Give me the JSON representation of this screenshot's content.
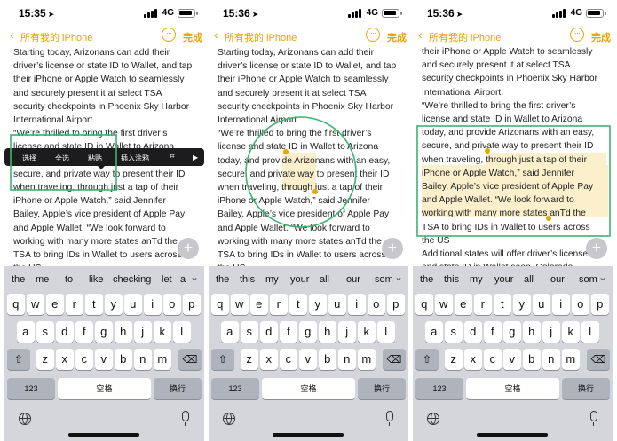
{
  "status": {
    "time_1": "15:35",
    "time_2": "15:36",
    "time_3": "15:36",
    "network": "4G"
  },
  "nav": {
    "back_label": "所有我的 iPhone",
    "done_label": "完成"
  },
  "note_lines_a": [
    "Starting today, Arizonans can add their",
    "driver’s license or state ID to Wallet, and tap",
    "their iPhone or Apple Watch to seamlessly",
    "and securely present it at select TSA",
    "security checkpoints in Phoenix Sky Harbor",
    "International Airport.",
    "“We’re thrilled to bring the first driver’s",
    "license and state ID in Wallet to Arizona",
    "today, and provide Arizonans with an easy,",
    "secure, and private way to present their ID",
    "when traveling, through just a tap of their",
    "iPhone or Apple Watch,” said Jennifer",
    "Bailey, Apple’s vice president of Apple Pay",
    "and Apple Wallet. “We look forward to",
    "working with many more states anTd the",
    "TSA to bring IDs in Wallet to users across",
    "the US"
  ],
  "note_lines_c": [
    "their iPhone or Apple Watch to seamlessly",
    "and securely present it at select TSA",
    "security checkpoints in Phoenix Sky Harbor",
    "International Airport.",
    "“We’re thrilled to bring the first driver’s",
    "license and state ID in Wallet to Arizona",
    "today, and provide Arizonans with an easy,",
    "secure, and private way to present their ID",
    "when traveling, through just a tap of their",
    "iPhone or Apple Watch,” said Jennifer",
    "Bailey, Apple’s vice president of Apple Pay",
    "and Apple Wallet. “We look forward to",
    "working with many more states anTd the",
    "TSA to bring IDs in Wallet to users across",
    "the US",
    "Additional states will offer driver’s license",
    "and state ID in Wallet soon. Colorado,"
  ],
  "context_menu": {
    "items": [
      "选择",
      "全选",
      "粘贴",
      "插入涂鸦",
      "▶"
    ]
  },
  "suggestions_a": [
    "the",
    "me",
    "to",
    "like",
    "checking",
    "let",
    "a"
  ],
  "suggestions_b": [
    "the",
    "this",
    "my",
    "your",
    "all",
    "our",
    "som"
  ],
  "keyboard": {
    "row1": [
      "q",
      "w",
      "e",
      "r",
      "t",
      "y",
      "u",
      "i",
      "o",
      "p"
    ],
    "row2": [
      "a",
      "s",
      "d",
      "f",
      "g",
      "h",
      "j",
      "k",
      "l"
    ],
    "row3": [
      "z",
      "x",
      "c",
      "v",
      "b",
      "n",
      "m"
    ],
    "num_label": "123",
    "space_label": "空格",
    "return_label": "换行",
    "shift_icon": "shift-icon",
    "delete_icon": "delete-icon"
  },
  "colors": {
    "accent": "#e6a400",
    "annotation": "#3cb371",
    "highlight": "#f3d06e"
  }
}
